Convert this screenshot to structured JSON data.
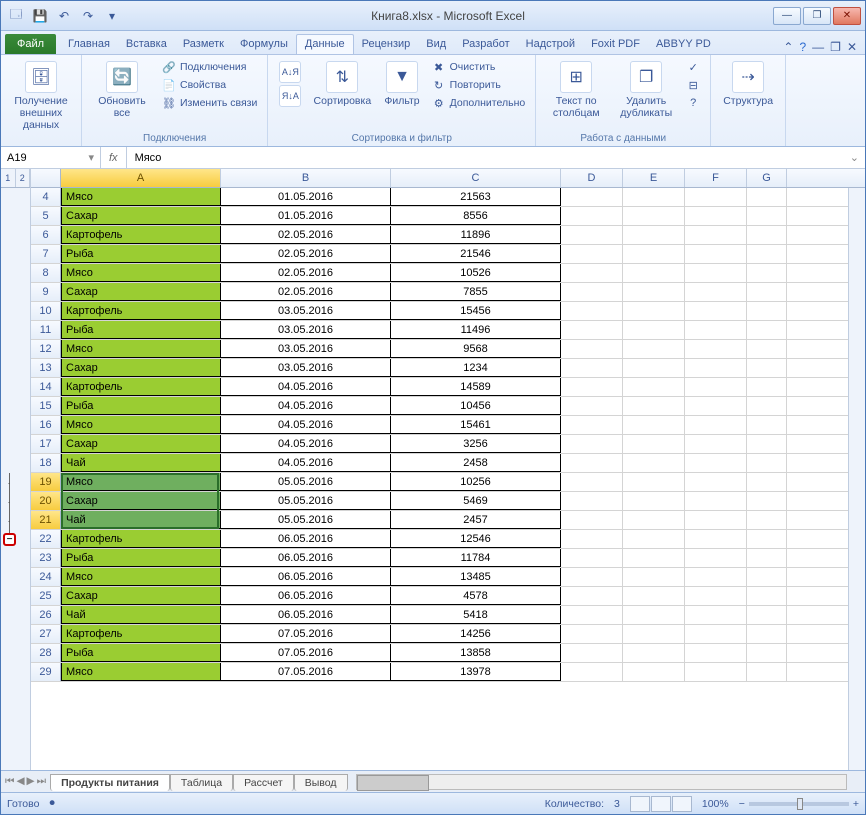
{
  "title": "Книга8.xlsx - Microsoft Excel",
  "qat": {
    "save": "💾",
    "undo": "↶",
    "redo": "↷"
  },
  "tabs": {
    "file": "Файл",
    "home": "Главная",
    "insert": "Вставка",
    "layout": "Разметк",
    "formulas": "Формулы",
    "data": "Данные",
    "review": "Рецензир",
    "view": "Вид",
    "dev": "Разработ",
    "addins": "Надстрой",
    "foxit": "Foxit PDF",
    "abbyy": "ABBYY PD"
  },
  "ribbon": {
    "g1": {
      "label": "",
      "ext": "Получение внешних данных"
    },
    "g2": {
      "label": "Подключения",
      "refresh": "Обновить все",
      "conn": "Подключения",
      "props": "Свойства",
      "links": "Изменить связи"
    },
    "g3": {
      "label": "Сортировка и фильтр",
      "sort": "Сортировка",
      "filter": "Фильтр",
      "clear": "Очистить",
      "reapply": "Повторить",
      "adv": "Дополнительно"
    },
    "g4": {
      "label": "Работа с данными",
      "ttc": "Текст по столбцам",
      "dup": "Удалить дубликаты"
    },
    "g5": {
      "label": "",
      "struct": "Структура"
    }
  },
  "namebox": "A19",
  "fx": "Мясо",
  "cols": [
    "A",
    "B",
    "C",
    "D",
    "E",
    "F",
    "G"
  ],
  "outline_levels": [
    "1",
    "2"
  ],
  "rows": [
    {
      "n": 4,
      "a": "Мясо",
      "b": "01.05.2016",
      "c": "21563"
    },
    {
      "n": 5,
      "a": "Сахар",
      "b": "01.05.2016",
      "c": "8556"
    },
    {
      "n": 6,
      "a": "Картофель",
      "b": "02.05.2016",
      "c": "11896"
    },
    {
      "n": 7,
      "a": "Рыба",
      "b": "02.05.2016",
      "c": "21546"
    },
    {
      "n": 8,
      "a": "Мясо",
      "b": "02.05.2016",
      "c": "10526"
    },
    {
      "n": 9,
      "a": "Сахар",
      "b": "02.05.2016",
      "c": "7855"
    },
    {
      "n": 10,
      "a": "Картофель",
      "b": "03.05.2016",
      "c": "15456"
    },
    {
      "n": 11,
      "a": "Рыба",
      "b": "03.05.2016",
      "c": "11496"
    },
    {
      "n": 12,
      "a": "Мясо",
      "b": "03.05.2016",
      "c": "9568"
    },
    {
      "n": 13,
      "a": "Сахар",
      "b": "03.05.2016",
      "c": "1234"
    },
    {
      "n": 14,
      "a": "Картофель",
      "b": "04.05.2016",
      "c": "14589"
    },
    {
      "n": 15,
      "a": "Рыба",
      "b": "04.05.2016",
      "c": "10456"
    },
    {
      "n": 16,
      "a": "Мясо",
      "b": "04.05.2016",
      "c": "15461"
    },
    {
      "n": 17,
      "a": "Сахар",
      "b": "04.05.2016",
      "c": "3256"
    },
    {
      "n": 18,
      "a": "Чай",
      "b": "04.05.2016",
      "c": "2458"
    },
    {
      "n": 19,
      "a": "Мясо",
      "b": "05.05.2016",
      "c": "10256",
      "sel": true
    },
    {
      "n": 20,
      "a": "Сахар",
      "b": "05.05.2016",
      "c": "5469",
      "sel": true
    },
    {
      "n": 21,
      "a": "Чай",
      "b": "05.05.2016",
      "c": "2457",
      "sel": true
    },
    {
      "n": 22,
      "a": "Картофель",
      "b": "06.05.2016",
      "c": "12546"
    },
    {
      "n": 23,
      "a": "Рыба",
      "b": "06.05.2016",
      "c": "11784"
    },
    {
      "n": 24,
      "a": "Мясо",
      "b": "06.05.2016",
      "c": "13485"
    },
    {
      "n": 25,
      "a": "Сахар",
      "b": "06.05.2016",
      "c": "4578"
    },
    {
      "n": 26,
      "a": "Чай",
      "b": "06.05.2016",
      "c": "5418"
    },
    {
      "n": 27,
      "a": "Картофель",
      "b": "07.05.2016",
      "c": "14256"
    },
    {
      "n": 28,
      "a": "Рыба",
      "b": "07.05.2016",
      "c": "13858"
    },
    {
      "n": 29,
      "a": "Мясо",
      "b": "07.05.2016",
      "c": "13978"
    }
  ],
  "outline_toggle": "−",
  "sheets": {
    "active": "Продукты питания",
    "others": [
      "Таблица",
      "Рассчет",
      "Вывод"
    ]
  },
  "status": {
    "ready": "Готово",
    "count_lbl": "Количество:",
    "count_val": "3",
    "zoom": "100%",
    "minus": "−",
    "plus": "+"
  }
}
